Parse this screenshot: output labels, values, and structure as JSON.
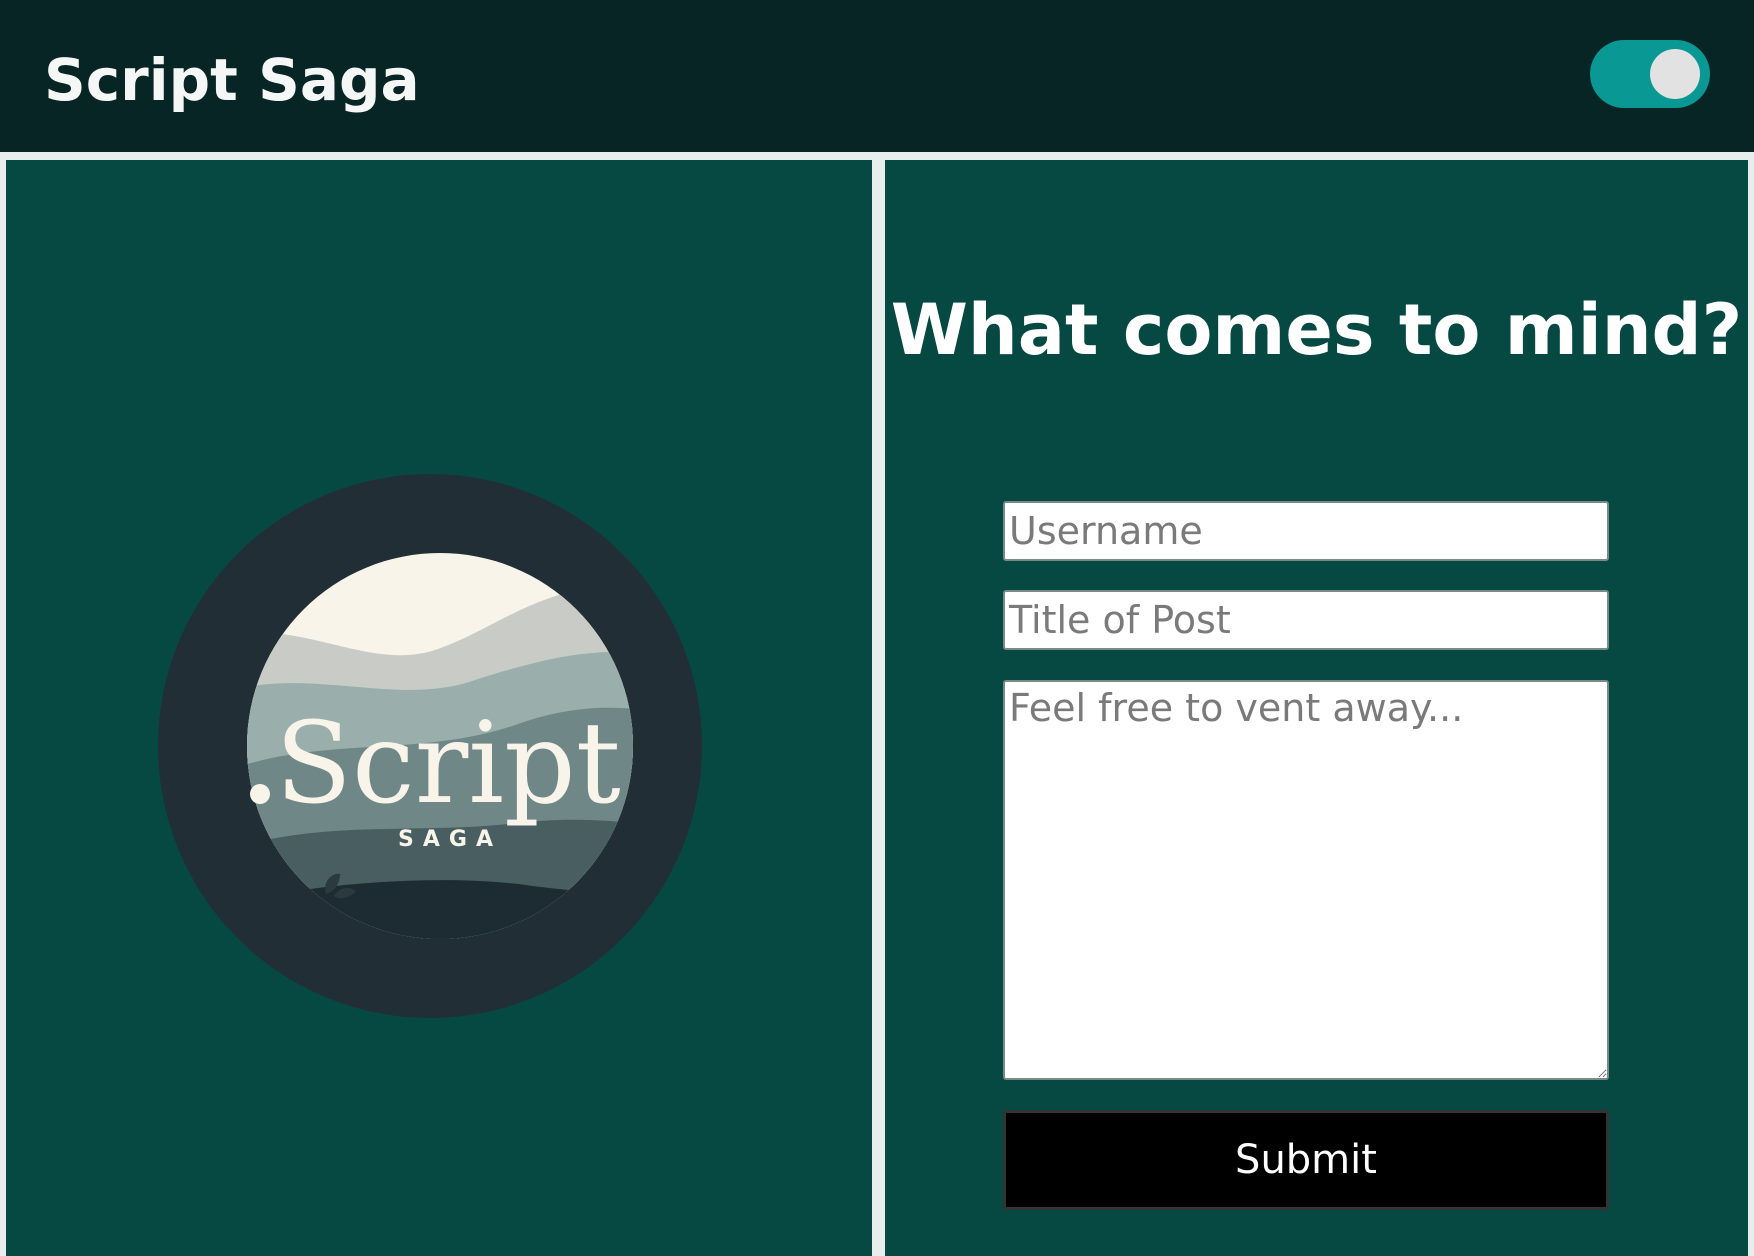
{
  "header": {
    "site_title": "Script Saga",
    "theme_toggle_on": true
  },
  "logo": {
    "wordmark": "Script",
    "subtitle": "SAGA"
  },
  "form": {
    "heading": "What comes to mind?",
    "username_placeholder": "Username",
    "username_value": "",
    "title_placeholder": "Title of Post",
    "title_value": "",
    "body_placeholder": "Feel free to vent away...",
    "body_value": "",
    "submit_label": "Submit"
  },
  "colors": {
    "header_bg": "#072524",
    "panel_bg": "#054942",
    "toggle_accent": "#0a9894",
    "button_bg": "#000000"
  }
}
